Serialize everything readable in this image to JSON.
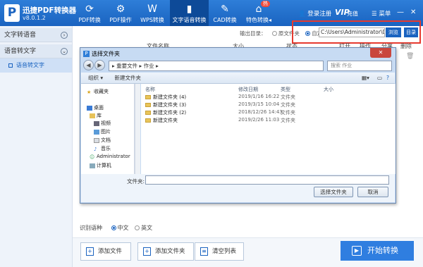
{
  "app": {
    "name": "迅捷PDF转换器",
    "version": "v8.0.1.2",
    "logo": "P"
  },
  "nav": {
    "tabs": [
      {
        "label": "PDF转换",
        "icon": "pdf-convert-icon",
        "glyph": "⟳"
      },
      {
        "label": "PDF操作",
        "icon": "pdf-ops-icon",
        "glyph": "⚙"
      },
      {
        "label": "WPS转换",
        "icon": "wps-icon",
        "glyph": "W"
      },
      {
        "label": "文字语音转换",
        "icon": "audio-icon",
        "glyph": "▮"
      },
      {
        "label": "CAD转换",
        "icon": "cad-icon",
        "glyph": "✎"
      },
      {
        "label": "特色转换◂",
        "icon": "feature-icon",
        "glyph": "⌂"
      }
    ],
    "hot_badge": "热",
    "login": "登录注册",
    "vip": "VIP",
    "vip_sub": "充值",
    "menu": "菜单",
    "min_glyph": "—",
    "close_glyph": "✕"
  },
  "sidebar": {
    "groups": [
      {
        "label": "文字转语音",
        "chevron": "›"
      },
      {
        "label": "语音转文字",
        "chevron": "⌄"
      }
    ],
    "subitem": "语音转文字"
  },
  "output": {
    "label": "输出目录：",
    "opt_source": "原文件夹",
    "opt_custom": "自定义",
    "path": "C:\\Users\\Administrator\\Desktop",
    "browse": "浏览",
    "dir": "目录"
  },
  "columns": [
    "文件名称",
    "大小",
    "状态",
    "打开",
    "操作",
    "分享",
    "删除"
  ],
  "lang": {
    "label": "识别语种",
    "zh": "中文",
    "en": "英文"
  },
  "buttons": {
    "add_file": "添加文件",
    "add_folder": "添加文件夹",
    "clear": "清空列表",
    "start": "开始转换"
  },
  "dialog": {
    "title": "选择文件夹",
    "close": "✕",
    "back": "◀",
    "forward": "▶",
    "address": "▸  重要文件  ▸  作业  ▸",
    "search_placeholder": "搜索 作业",
    "organize": "组织 ▾",
    "new_folder": "新建文件夹",
    "tree": [
      {
        "label": "收藏夹",
        "icon": "star-icon"
      },
      {
        "label": "桌面",
        "icon": "desktop-icon"
      },
      {
        "label": "库",
        "icon": "library-icon"
      },
      {
        "label": "视频",
        "icon": "video-icon"
      },
      {
        "label": "图片",
        "icon": "picture-icon"
      },
      {
        "label": "文档",
        "icon": "document-icon"
      },
      {
        "label": "音乐",
        "icon": "music-icon"
      },
      {
        "label": "Administrator",
        "icon": "user-icon"
      },
      {
        "label": "计算机",
        "icon": "computer-icon"
      }
    ],
    "headers": {
      "name": "名称",
      "date": "修改日期",
      "type": "类型",
      "size": "大小"
    },
    "rows": [
      {
        "name": "新建文件夹 (4)",
        "date": "2019/1/16 16:22",
        "type": "文件夹"
      },
      {
        "name": "新建文件夹 (3)",
        "date": "2019/3/15 10:04",
        "type": "文件夹"
      },
      {
        "name": "新建文件夹 (2)",
        "date": "2018/12/26 14:43",
        "type": "文件夹"
      },
      {
        "name": "新建文件夹",
        "date": "2019/2/26 11:03",
        "type": "文件夹"
      }
    ],
    "filename_label": "文件夹:",
    "select_btn": "选择文件夹",
    "cancel_btn": "取消"
  },
  "colors": {
    "primary": "#1a63c0",
    "highlight": "#e63a2f"
  }
}
